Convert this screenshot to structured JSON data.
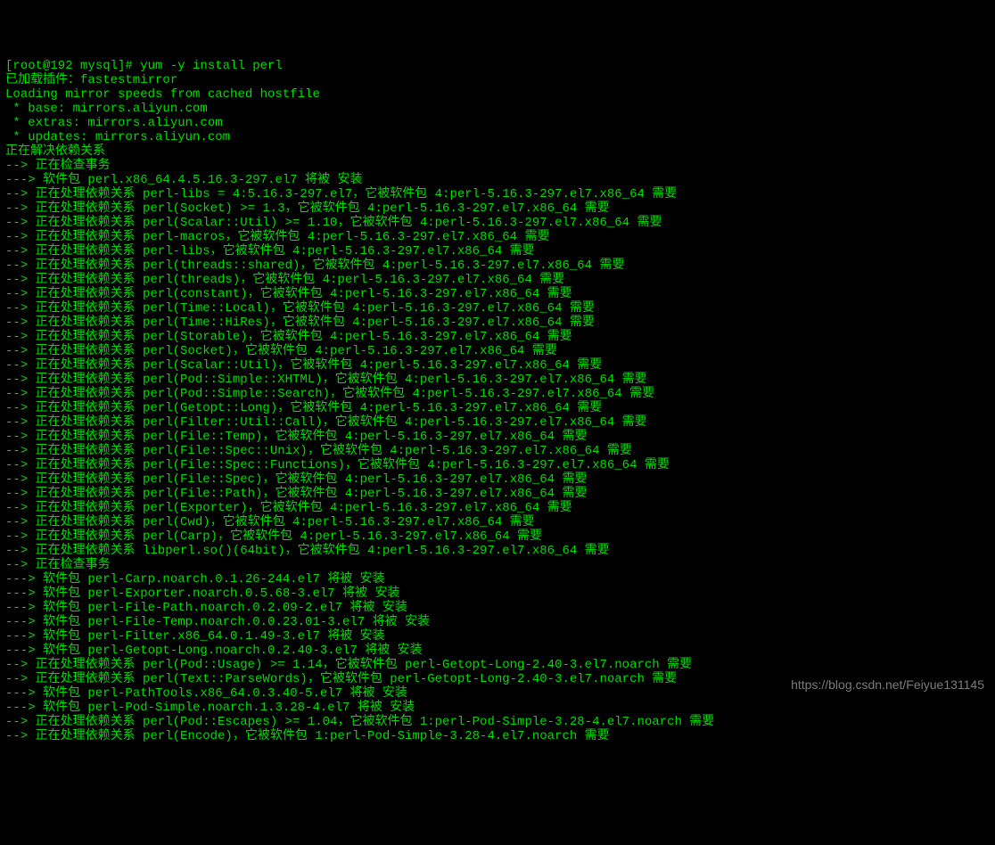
{
  "watermark": "https://blog.csdn.net/Feiyue131145",
  "lines": [
    "[root@192 mysql]# yum -y install perl",
    "已加载插件：fastestmirror",
    "Loading mirror speeds from cached hostfile",
    " * base: mirrors.aliyun.com",
    " * extras: mirrors.aliyun.com",
    " * updates: mirrors.aliyun.com",
    "正在解决依赖关系",
    "--> 正在检查事务",
    "---> 软件包 perl.x86_64.4.5.16.3-297.el7 将被 安装",
    "--> 正在处理依赖关系 perl-libs = 4:5.16.3-297.el7，它被软件包 4:perl-5.16.3-297.el7.x86_64 需要",
    "--> 正在处理依赖关系 perl(Socket) >= 1.3，它被软件包 4:perl-5.16.3-297.el7.x86_64 需要",
    "--> 正在处理依赖关系 perl(Scalar::Util) >= 1.10，它被软件包 4:perl-5.16.3-297.el7.x86_64 需要",
    "--> 正在处理依赖关系 perl-macros，它被软件包 4:perl-5.16.3-297.el7.x86_64 需要",
    "--> 正在处理依赖关系 perl-libs，它被软件包 4:perl-5.16.3-297.el7.x86_64 需要",
    "--> 正在处理依赖关系 perl(threads::shared)，它被软件包 4:perl-5.16.3-297.el7.x86_64 需要",
    "--> 正在处理依赖关系 perl(threads)，它被软件包 4:perl-5.16.3-297.el7.x86_64 需要",
    "--> 正在处理依赖关系 perl(constant)，它被软件包 4:perl-5.16.3-297.el7.x86_64 需要",
    "--> 正在处理依赖关系 perl(Time::Local)，它被软件包 4:perl-5.16.3-297.el7.x86_64 需要",
    "--> 正在处理依赖关系 perl(Time::HiRes)，它被软件包 4:perl-5.16.3-297.el7.x86_64 需要",
    "--> 正在处理依赖关系 perl(Storable)，它被软件包 4:perl-5.16.3-297.el7.x86_64 需要",
    "--> 正在处理依赖关系 perl(Socket)，它被软件包 4:perl-5.16.3-297.el7.x86_64 需要",
    "--> 正在处理依赖关系 perl(Scalar::Util)，它被软件包 4:perl-5.16.3-297.el7.x86_64 需要",
    "--> 正在处理依赖关系 perl(Pod::Simple::XHTML)，它被软件包 4:perl-5.16.3-297.el7.x86_64 需要",
    "--> 正在处理依赖关系 perl(Pod::Simple::Search)，它被软件包 4:perl-5.16.3-297.el7.x86_64 需要",
    "--> 正在处理依赖关系 perl(Getopt::Long)，它被软件包 4:perl-5.16.3-297.el7.x86_64 需要",
    "--> 正在处理依赖关系 perl(Filter::Util::Call)，它被软件包 4:perl-5.16.3-297.el7.x86_64 需要",
    "--> 正在处理依赖关系 perl(File::Temp)，它被软件包 4:perl-5.16.3-297.el7.x86_64 需要",
    "--> 正在处理依赖关系 perl(File::Spec::Unix)，它被软件包 4:perl-5.16.3-297.el7.x86_64 需要",
    "--> 正在处理依赖关系 perl(File::Spec::Functions)，它被软件包 4:perl-5.16.3-297.el7.x86_64 需要",
    "--> 正在处理依赖关系 perl(File::Spec)，它被软件包 4:perl-5.16.3-297.el7.x86_64 需要",
    "--> 正在处理依赖关系 perl(File::Path)，它被软件包 4:perl-5.16.3-297.el7.x86_64 需要",
    "--> 正在处理依赖关系 perl(Exporter)，它被软件包 4:perl-5.16.3-297.el7.x86_64 需要",
    "--> 正在处理依赖关系 perl(Cwd)，它被软件包 4:perl-5.16.3-297.el7.x86_64 需要",
    "--> 正在处理依赖关系 perl(Carp)，它被软件包 4:perl-5.16.3-297.el7.x86_64 需要",
    "--> 正在处理依赖关系 libperl.so()(64bit)，它被软件包 4:perl-5.16.3-297.el7.x86_64 需要",
    "--> 正在检查事务",
    "---> 软件包 perl-Carp.noarch.0.1.26-244.el7 将被 安装",
    "---> 软件包 perl-Exporter.noarch.0.5.68-3.el7 将被 安装",
    "---> 软件包 perl-File-Path.noarch.0.2.09-2.el7 将被 安装",
    "---> 软件包 perl-File-Temp.noarch.0.0.23.01-3.el7 将被 安装",
    "---> 软件包 perl-Filter.x86_64.0.1.49-3.el7 将被 安装",
    "---> 软件包 perl-Getopt-Long.noarch.0.2.40-3.el7 将被 安装",
    "--> 正在处理依赖关系 perl(Pod::Usage) >= 1.14，它被软件包 perl-Getopt-Long-2.40-3.el7.noarch 需要",
    "--> 正在处理依赖关系 perl(Text::ParseWords)，它被软件包 perl-Getopt-Long-2.40-3.el7.noarch 需要",
    "---> 软件包 perl-PathTools.x86_64.0.3.40-5.el7 将被 安装",
    "---> 软件包 perl-Pod-Simple.noarch.1.3.28-4.el7 将被 安装",
    "--> 正在处理依赖关系 perl(Pod::Escapes) >= 1.04，它被软件包 1:perl-Pod-Simple-3.28-4.el7.noarch 需要",
    "--> 正在处理依赖关系 perl(Encode)，它被软件包 1:perl-Pod-Simple-3.28-4.el7.noarch 需要"
  ]
}
